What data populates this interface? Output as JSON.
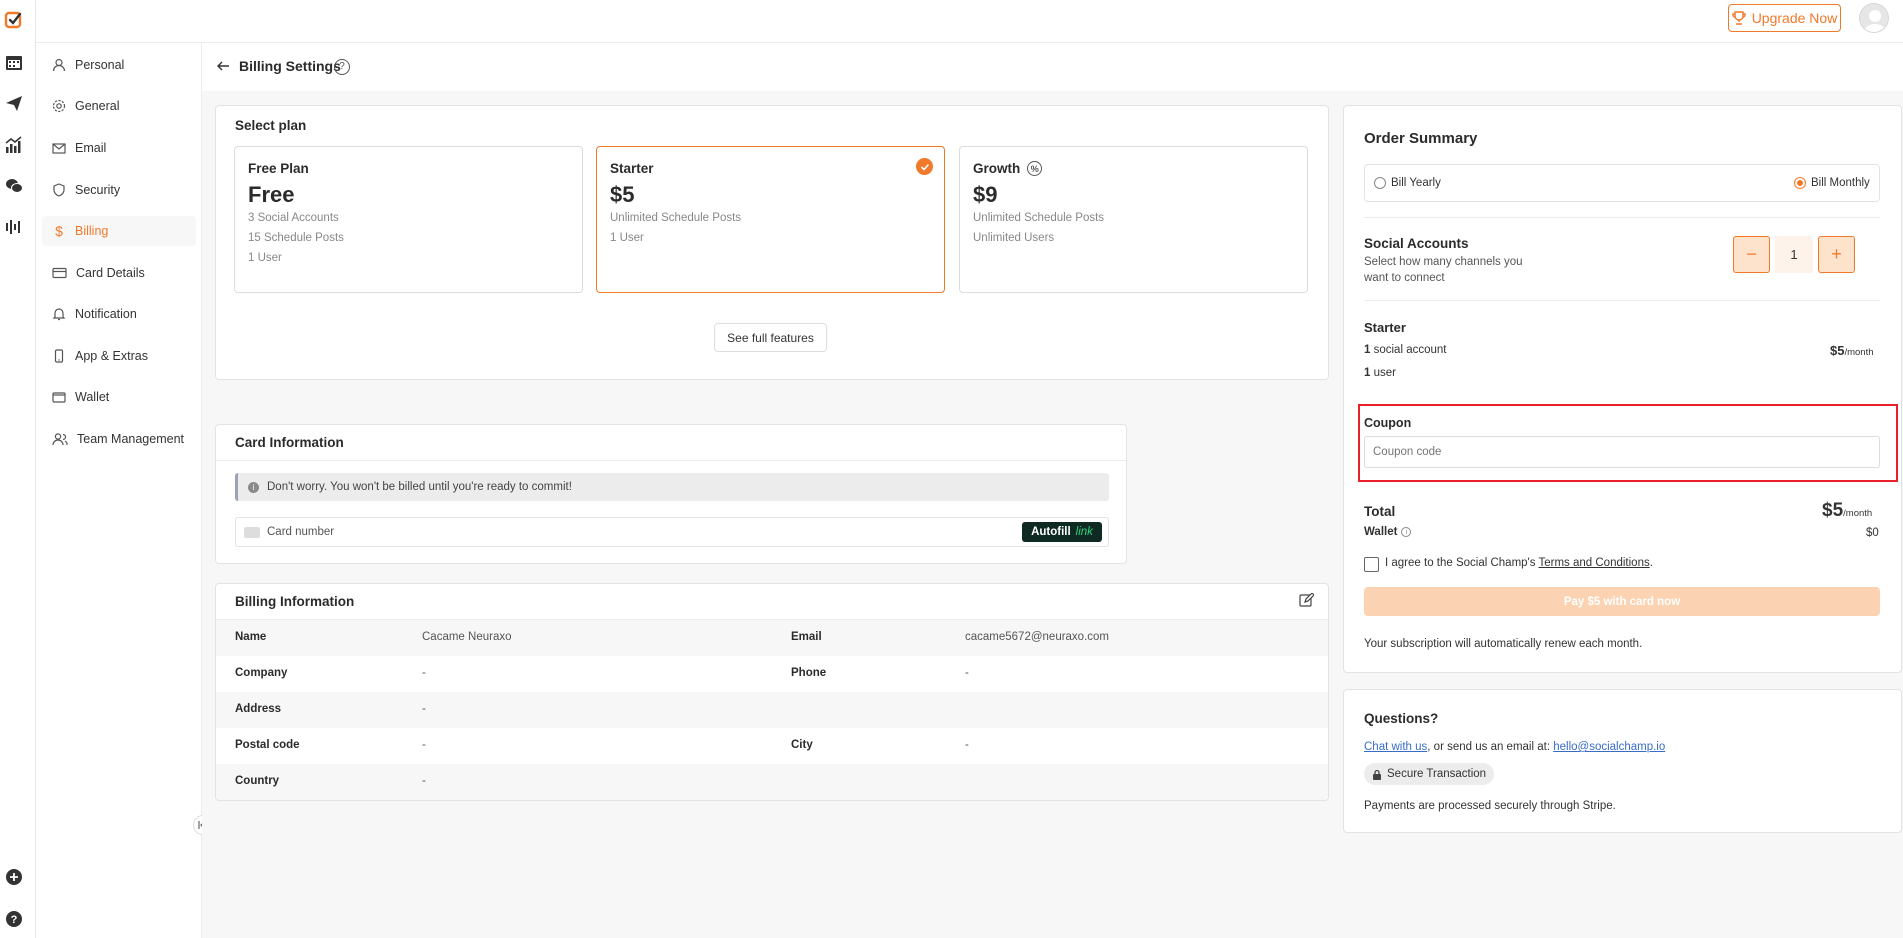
{
  "topbar": {
    "upgrade_label": "Upgrade Now"
  },
  "rail_icons": [
    "logo-icon",
    "calendar-icon",
    "send-icon",
    "analytics-icon",
    "chat-icon",
    "audio-icon",
    "add-icon",
    "help-icon"
  ],
  "sidebar": {
    "items": [
      {
        "label": "Personal",
        "icon": "user-icon"
      },
      {
        "label": "General",
        "icon": "gear-icon"
      },
      {
        "label": "Email",
        "icon": "mail-icon"
      },
      {
        "label": "Security",
        "icon": "shield-icon"
      },
      {
        "label": "Billing",
        "icon": "dollar-icon",
        "active": true
      },
      {
        "label": "Card Details",
        "icon": "card-icon"
      },
      {
        "label": "Notification",
        "icon": "bell-icon"
      },
      {
        "label": "App & Extras",
        "icon": "phone-icon"
      },
      {
        "label": "Wallet",
        "icon": "wallet-icon"
      },
      {
        "label": "Team Management",
        "icon": "team-icon"
      }
    ]
  },
  "page": {
    "title": "Billing Settings"
  },
  "select_plan": {
    "title": "Select plan",
    "plans": [
      {
        "name": "Free Plan",
        "price": "Free",
        "features": [
          "3 Social Accounts",
          "15 Schedule Posts",
          "1 User"
        ]
      },
      {
        "name": "Starter",
        "price": "$5",
        "features": [
          "Unlimited Schedule Posts",
          "1 User"
        ],
        "selected": true
      },
      {
        "name": "Growth",
        "price": "$9",
        "features": [
          "Unlimited Schedule Posts",
          "Unlimited Users"
        ]
      }
    ],
    "see_features_label": "See full features"
  },
  "card_info": {
    "title": "Card Information",
    "notice": "Don't worry. You won't be billed until you're ready to commit!",
    "card_placeholder": "Card number",
    "autofill_label": "Autofill",
    "link_label": "link"
  },
  "billing_info": {
    "title": "Billing Information",
    "rows": [
      {
        "l1": "Name",
        "v1": "Cacame Neuraxo",
        "l2": "Email",
        "v2": "cacame5672@neuraxo.com"
      },
      {
        "l1": "Company",
        "v1": "-",
        "l2": "Phone",
        "v2": "-"
      },
      {
        "l1": "Address",
        "v1": "-",
        "l2": "",
        "v2": ""
      },
      {
        "l1": "Postal code",
        "v1": "-",
        "l2": "City",
        "v2": "-"
      },
      {
        "l1": "Country",
        "v1": "-",
        "l2": "",
        "v2": ""
      }
    ]
  },
  "order_summary": {
    "title": "Order Summary",
    "bill_yearly": "Bill Yearly",
    "bill_monthly": "Bill Monthly",
    "selected_billing": "monthly",
    "social_title": "Social Accounts",
    "social_desc_1": "Select how many channels you",
    "social_desc_2": "want to connect",
    "quantity": "1",
    "minus": "−",
    "plus": "+",
    "plan_name": "Starter",
    "line1_count": "1",
    "line1_text": "social account",
    "line1_price": "$5",
    "line1_unit": "/month",
    "line2_count": "1",
    "line2_text": "user",
    "coupon_label": "Coupon",
    "coupon_placeholder": "Coupon code",
    "total_label": "Total",
    "total_price": "$5",
    "total_unit": "/month",
    "wallet_label": "Wallet",
    "wallet_value": "$0",
    "agree_prefix": "I agree to the Social Champ's ",
    "agree_link": "Terms and Conditions",
    "agree_suffix": ".",
    "pay_label": "Pay $5 with card now",
    "renew_text": "Your subscription will automatically renew each month."
  },
  "questions": {
    "title": "Questions?",
    "chat_link": "Chat with us",
    "middle_text": ", or send us an email at: ",
    "email_link": "hello@socialchamp.io",
    "secure_label": "Secure Transaction",
    "stripe_text": "Payments are processed securely through Stripe."
  },
  "colors": {
    "accent": "#f0792a",
    "highlight": "#e8202a"
  }
}
